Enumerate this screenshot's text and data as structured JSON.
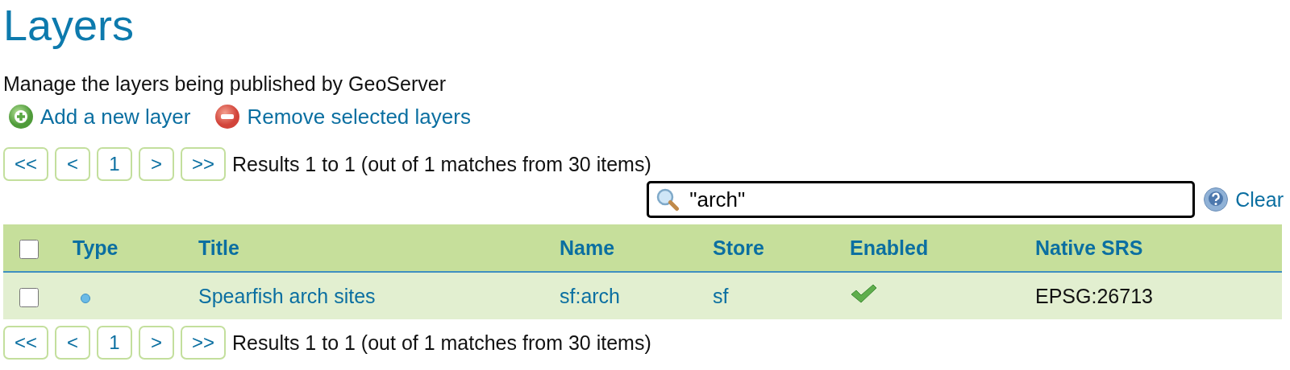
{
  "title": "Layers",
  "description": "Manage the layers being published by GeoServer",
  "actions": [
    {
      "kind": "add",
      "label": "Add a new layer"
    },
    {
      "kind": "remove",
      "label": "Remove selected layers"
    }
  ],
  "pager_top": {
    "buttons": [
      "<<",
      "<",
      "1",
      ">",
      ">>"
    ],
    "summary": "Results 1 to 1 (out of 1 matches from 30 items)"
  },
  "search": {
    "value": "\"arch\"",
    "clear": "Clear"
  },
  "table": {
    "select_all_checked": false,
    "columns": [
      "Type",
      "Title",
      "Name",
      "Store",
      "Enabled",
      "Native SRS"
    ],
    "rows": [
      {
        "checked": false,
        "kind": "point",
        "title": "Spearfish arch sites",
        "name": "sf:arch",
        "store": "sf",
        "enabled": true,
        "srs": "EPSG:26713"
      }
    ]
  },
  "pager_bottom": {
    "buttons": [
      "<<",
      "<",
      "1",
      ">",
      ">>"
    ],
    "summary": "Results 1 to 1 (out of 1 matches from 30 items)"
  }
}
